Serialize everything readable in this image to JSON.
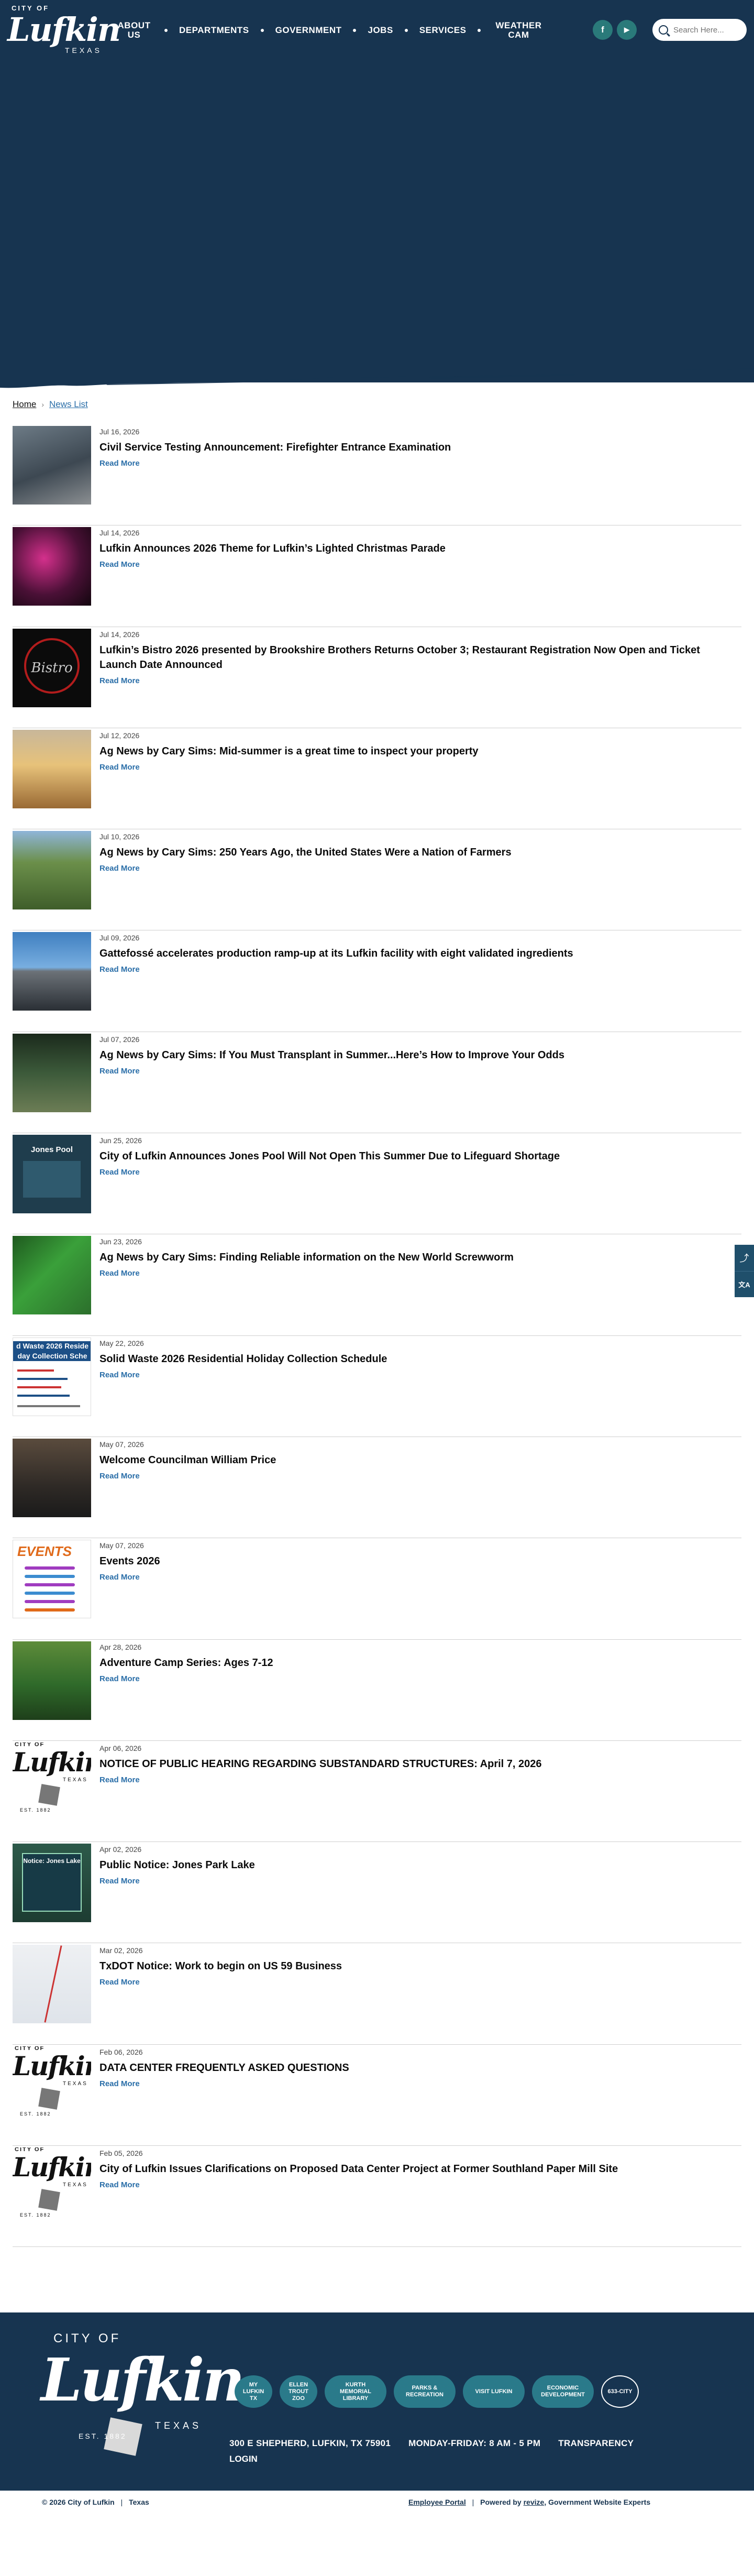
{
  "header": {
    "logo": {
      "city_of": "CITY OF",
      "name": "Lufkin",
      "state": "TEXAS"
    },
    "nav": [
      {
        "label": "ABOUT US"
      },
      {
        "label": "DEPARTMENTS"
      },
      {
        "label": "GOVERNMENT"
      },
      {
        "label": "JOBS"
      },
      {
        "label": "SERVICES"
      },
      {
        "label": "WEATHER CAM"
      }
    ],
    "social": [
      {
        "icon": "facebook-icon",
        "glyph": "f"
      },
      {
        "icon": "youtube-icon",
        "glyph": "▶"
      }
    ],
    "search": {
      "placeholder": "Search Here..."
    },
    "colors": {
      "primary": "#173450",
      "accent": "#2a7a7a",
      "link": "#2a6ea8"
    }
  },
  "breadcrumb": {
    "home": "Home",
    "current": "News List"
  },
  "news": [
    {
      "date": "Jul 16, 2026",
      "title": "Civil Service Testing Announcement: Firefighter Entrance Examination",
      "read_more": "Read More"
    },
    {
      "date": "Jul 14, 2026",
      "title": "Lufkin Announces 2026 Theme for Lufkin’s Lighted Christmas Parade",
      "read_more": "Read More"
    },
    {
      "date": "Jul 14, 2026",
      "title": "Lufkin’s Bistro 2026 presented by Brookshire Brothers Returns October 3; Restaurant Registration Now Open and Ticket Launch Date Announced",
      "read_more": "Read More"
    },
    {
      "date": "Jul 12, 2026",
      "title": "Ag News by Cary Sims: Mid-summer is a great time to inspect your property",
      "read_more": "Read More"
    },
    {
      "date": "Jul 10, 2026",
      "title": "Ag News by Cary Sims: 250 Years Ago, the United States Were a Nation of Farmers",
      "read_more": "Read More"
    },
    {
      "date": "Jul 09, 2026",
      "title": "Gattefossé accelerates production ramp-up at its Lufkin facility with eight validated ingredients",
      "read_more": "Read More"
    },
    {
      "date": "Jul 07, 2026",
      "title": "Ag News by Cary Sims: If You Must Transplant in Summer...Here’s How to Improve Your Odds",
      "read_more": "Read More"
    },
    {
      "date": "Jun 25, 2026",
      "title": "City of Lufkin Announces Jones Pool Will Not Open This Summer Due to Lifeguard Shortage",
      "read_more": "Read More"
    },
    {
      "date": "Jun 23, 2026",
      "title": "Ag News by Cary Sims: Finding Reliable information on the New World Screwworm",
      "read_more": "Read More"
    },
    {
      "date": "May 22, 2026",
      "title": "Solid Waste 2026 Residential Holiday Collection Schedule",
      "read_more": "Read More"
    },
    {
      "date": "May 07, 2026",
      "title": "Welcome Councilman William Price",
      "read_more": "Read More"
    },
    {
      "date": "May 07, 2026",
      "title": "Events 2026",
      "read_more": "Read More"
    },
    {
      "date": "Apr 28, 2026",
      "title": "Adventure Camp Series: Ages 7-12",
      "read_more": "Read More"
    },
    {
      "date": "Apr 06, 2026",
      "title": "NOTICE OF PUBLIC HEARING REGARDING SUBSTANDARD STRUCTURES: April 7, 2026",
      "read_more": "Read More"
    },
    {
      "date": "Apr 02, 2026",
      "title": "Public Notice: Jones Park Lake",
      "read_more": "Read More"
    },
    {
      "date": "Mar 02, 2026",
      "title": "TxDOT Notice: Work to begin on US 59 Business",
      "read_more": "Read More"
    },
    {
      "date": "Feb 06, 2026",
      "title": "DATA CENTER FREQUENTLY ASKED QUESTIONS",
      "read_more": "Read More"
    },
    {
      "date": "Feb 05, 2026",
      "title": "City of Lufkin Issues Clarifications on Proposed Data Center Project at Former Southland Paper Mill Site",
      "read_more": "Read More"
    }
  ],
  "thumbs": {
    "bistro_text": "Bistro",
    "pool_text": "Jones Pool",
    "waste_header": "d Waste 2026 Reside day Collection Sche",
    "events_text": "EVENTS",
    "lake_text": "Notice: Jones Lake",
    "logo_city_of": "CITY OF",
    "logo_name": "Lufkin",
    "logo_state": "TEXAS",
    "logo_est": "EST. 1882"
  },
  "footer": {
    "logo": {
      "city_of": "CITY OF",
      "name": "Lufkin",
      "state": "TEXAS",
      "est": "EST. 1882"
    },
    "links": [
      {
        "label": "MY LUFKIN TX",
        "shape": "round"
      },
      {
        "label": "ELLEN TROUT ZOO",
        "shape": "round"
      },
      {
        "label": "KURTH MEMORIAL LIBRARY",
        "shape": "pill"
      },
      {
        "label": "PARKS & RECREATION",
        "shape": "pill"
      },
      {
        "label": "VISIT LUFKIN",
        "shape": "pill"
      },
      {
        "label": "ECONOMIC DEVELOPMENT",
        "shape": "pill"
      },
      {
        "label": "633-CITY",
        "shape": "round"
      }
    ],
    "address": "300 E SHEPHERD, LUFKIN, TX 75901",
    "hours": "MONDAY-FRIDAY: 8 AM - 5 PM",
    "transparency": "TRANSPARENCY",
    "login": "LOGIN",
    "copyright": "© 2026 City of Lufkin",
    "copyright_state": "Texas",
    "employee_portal": "Employee Portal",
    "powered_by": "Powered by",
    "revize": "revize",
    "revize_suffix": "Government Website Experts"
  },
  "share": {
    "share_icon": "share-icon",
    "translate_icon": "translate-icon"
  }
}
